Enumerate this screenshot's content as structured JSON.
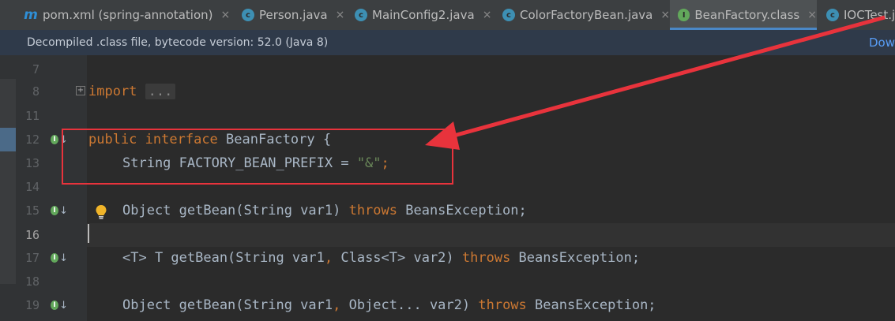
{
  "tabs": [
    {
      "icon": "maven-icon",
      "glyph": "m",
      "label": "pom.xml (spring-annotation)",
      "close": "×",
      "active": false
    },
    {
      "icon": "class-icon",
      "glyph": "c",
      "label": "Person.java",
      "close": "×",
      "active": false
    },
    {
      "icon": "class-icon",
      "glyph": "c",
      "label": "MainConfig2.java",
      "close": "×",
      "active": false
    },
    {
      "icon": "class-icon",
      "glyph": "c",
      "label": "ColorFactoryBean.java",
      "close": "×",
      "active": false
    },
    {
      "icon": "interface-icon",
      "glyph": "I",
      "label": "BeanFactory.class",
      "close": "×",
      "active": true
    },
    {
      "icon": "class-icon",
      "glyph": "c",
      "label": "IOCTest.j",
      "close": "",
      "active": false
    }
  ],
  "banner": {
    "text": "Decompiled .class file, bytecode version: 52.0 (Java 8)",
    "link": "Dow"
  },
  "lines": [
    {
      "num": "7",
      "code": ""
    },
    {
      "num": "8",
      "kw": "import",
      "fold": "..."
    },
    {
      "num": "11",
      "code": ""
    },
    {
      "num": "12",
      "kw1": "public",
      "kw2": "interface",
      "name": "BeanFactory",
      "brace": "{"
    },
    {
      "num": "13",
      "type": "String FACTORY_BEAN_PREFIX = ",
      "str": "\"&\"",
      "semi": ";"
    },
    {
      "num": "14",
      "code": ""
    },
    {
      "num": "15",
      "pre": "Object getBean(String var1) ",
      "kw": "throws",
      "post": " BeansException;"
    },
    {
      "num": "16",
      "code": ""
    },
    {
      "num": "17",
      "pre": "<T> T getBean(String var1",
      "comma": ",",
      "mid": " Class<T> var2) ",
      "kw": "throws",
      "post": " BeansException;"
    },
    {
      "num": "18",
      "code": ""
    },
    {
      "num": "19",
      "pre": "Object getBean(String var1",
      "comma": ",",
      "mid": " Object... var2) ",
      "kw": "throws",
      "post": " BeansException;"
    }
  ],
  "colors": {
    "keyword": "#cc7832",
    "string": "#6a8759",
    "text": "#a9b7c6",
    "annotation_red": "#e8333c",
    "active_tab_underline": "#4a88c7"
  }
}
